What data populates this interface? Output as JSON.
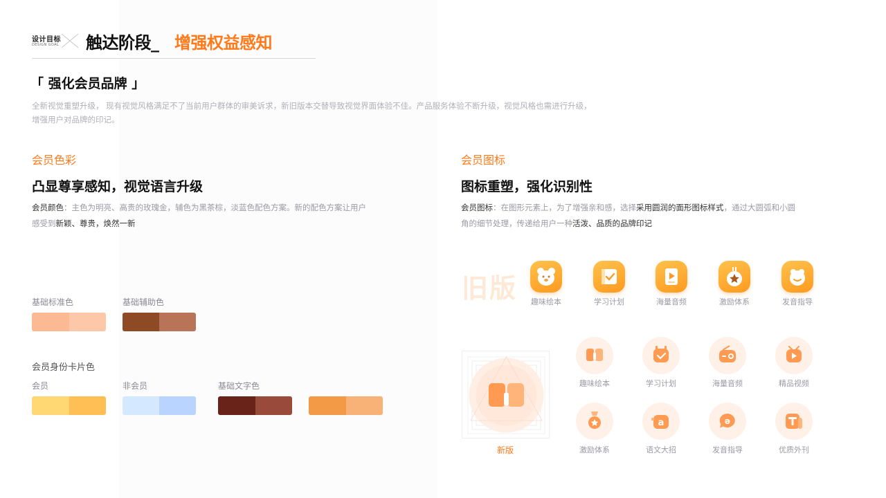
{
  "header": {
    "goal_cn": "设计目标",
    "goal_en": "DESIGN GOAL",
    "title_black": "触达阶段_",
    "title_orange": "增强权益感知"
  },
  "brand": {
    "title": "「 强化会员品牌 」",
    "intro_line1": "全新视觉重塑升级， 现有视觉风格满足不了当前用户群体的审美诉求，新旧版本交替导致视觉界面体验不佳。产品服务体验不断升级，视觉风格也需进行升级，",
    "intro_line2": "增强用户对品牌的印记。"
  },
  "color_section": {
    "label": "会员色彩",
    "heading": "凸显尊享感知，视觉语言升级",
    "desc_prefix": "会员颜色",
    "desc_rest_1": "：主色为明亮、高贵的玫瑰金，辅色为黑茶棕，淡蓝色配色方案。新的配色方案让用户",
    "desc_rest_2a": "感受到",
    "desc_rest_2b": "新颖、尊贵，焕然一新",
    "base_label": "基础标准色",
    "aux_label": "基础辅助色",
    "card_label": "会员身份卡片色",
    "member_label": "会员",
    "nonmember_label": "非会员",
    "text_color_label": "基础文字色",
    "colors": {
      "base": [
        "#fbb994",
        "#fdc8a8"
      ],
      "aux": [
        "#8e4a24",
        "#b97457"
      ],
      "member": [
        "#ffd873",
        "#ffbf55"
      ],
      "nonmember": [
        "#d4e9ff",
        "#b9d4ff"
      ],
      "text": [
        "#6a2318",
        "#9a4a3a"
      ],
      "extra": [
        "#f29a45",
        "#f8b277"
      ]
    }
  },
  "icon_section": {
    "label": "会员图标",
    "heading": "图标重塑，强化识别性",
    "desc_a": "会员图标",
    "desc_b": "：在图形元素上，为了增强亲和感，选择",
    "desc_c": "采用圆润的面形图标样式",
    "desc_d": "，通过大圆弧和小圆",
    "desc_e": "角的细节处理，传递给用户一种",
    "desc_f": "活泼、品质的品牌印记",
    "old_label": "旧版",
    "new_label": "新版",
    "old_icons": [
      {
        "name": "bear-icon",
        "caption": "趣味绘本"
      },
      {
        "name": "study-plan-icon",
        "caption": "学习计划"
      },
      {
        "name": "audio-play-icon",
        "caption": "海量音频"
      },
      {
        "name": "reward-star-icon",
        "caption": "激励体系"
      },
      {
        "name": "voice-guide-icon",
        "caption": "发音指导"
      }
    ],
    "new_icons": [
      {
        "name": "book-icon",
        "caption": "趣味绘本"
      },
      {
        "name": "calendar-check-icon",
        "caption": "学习计划"
      },
      {
        "name": "radio-icon",
        "caption": "海量音频"
      },
      {
        "name": "video-play-icon",
        "caption": "精品视频"
      },
      {
        "name": "medal-icon",
        "caption": "激励体系"
      },
      {
        "name": "letter-a-icon",
        "caption": "语文大招"
      },
      {
        "name": "speech-bubble-icon",
        "caption": "发音指导"
      },
      {
        "name": "text-t-icon",
        "caption": "优质外刊"
      }
    ]
  }
}
